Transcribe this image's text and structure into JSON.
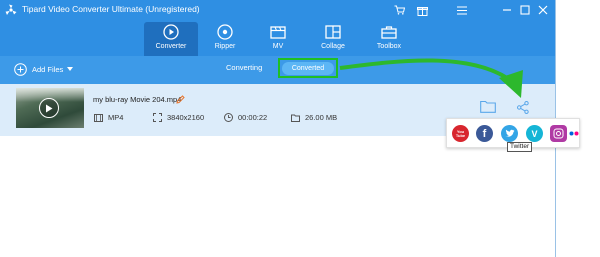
{
  "window": {
    "title": "Tipard Video Converter Ultimate (Unregistered)",
    "controls": [
      "cart-icon",
      "gift-icon",
      "menu-icon",
      "minimize-icon",
      "maximize-icon",
      "close-icon"
    ]
  },
  "nav": {
    "tabs": [
      {
        "label": "Converter",
        "icon": "converter-icon",
        "active": true
      },
      {
        "label": "Ripper",
        "icon": "ripper-icon",
        "active": false
      },
      {
        "label": "MV",
        "icon": "mv-icon",
        "active": false
      },
      {
        "label": "Collage",
        "icon": "collage-icon",
        "active": false
      },
      {
        "label": "Toolbox",
        "icon": "toolbox-icon",
        "active": false
      }
    ]
  },
  "toolbar": {
    "add_files_label": "Add Files",
    "converting_label": "Converting",
    "converted_label": "Converted"
  },
  "file": {
    "name": "my blu-ray Movie 204.mp4",
    "format": "MP4",
    "resolution": "3840x2160",
    "duration": "00:00:22",
    "size": "26.00 MB"
  },
  "share": {
    "services": [
      "youtube-icon",
      "facebook-icon",
      "twitter-icon",
      "vimeo-icon",
      "instagram-icon",
      "flickr-icon"
    ],
    "tooltip": "Twitter",
    "youtube_text": "You Tube",
    "facebook_text": "f",
    "vimeo_text": "V"
  },
  "colors": {
    "header_blue": "#2f8fe3",
    "active_tab": "#1f6fbe",
    "row_background": "#dcecfa",
    "highlight_green": "#1fbf23"
  }
}
